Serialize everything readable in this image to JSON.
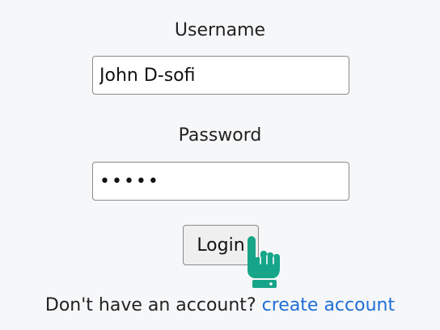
{
  "login_form": {
    "username_label": "Username",
    "username_value": "John D-sofi",
    "password_label": "Password",
    "password_value": "•••••",
    "login_button": "Login",
    "footer_text": "Don't have an account?",
    "footer_link": "create account"
  },
  "icons": {
    "cursor": "hand-pointer-icon"
  },
  "colors": {
    "link": "#1f6fd6",
    "cursor_fill": "#17a589"
  }
}
